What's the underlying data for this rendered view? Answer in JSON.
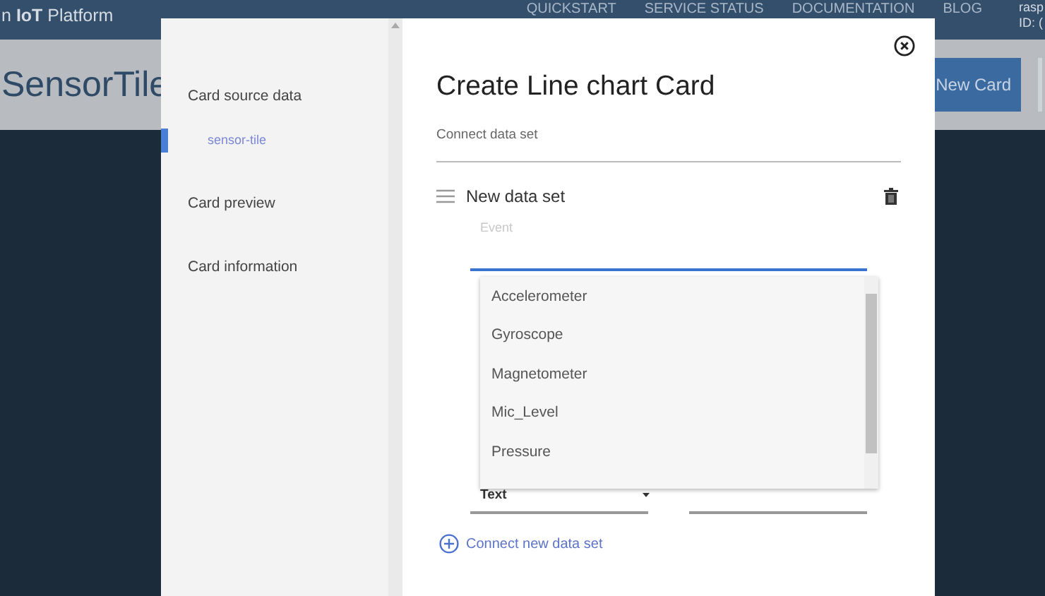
{
  "navbar": {
    "brand": "n **IoT** Platform",
    "links": [
      "QUICKSTART",
      "SERVICE STATUS",
      "DOCUMENTATION",
      "BLOG"
    ],
    "user_lines": [
      "rasp",
      "ID: ("
    ]
  },
  "page": {
    "title": "SensorTile",
    "button": "New Card"
  },
  "modal": {
    "sidebar": {
      "items": [
        {
          "label": "Card source data",
          "children": [
            {
              "label": "sensor-tile",
              "selected": true
            }
          ]
        },
        {
          "label": "Card preview"
        },
        {
          "label": "Card information"
        }
      ]
    },
    "title": "Create Line chart Card",
    "subtitle": "Connect data set",
    "data_set": {
      "name": "New data set",
      "event": {
        "placeholder": "Event",
        "focused": true
      },
      "options": [
        "Accelerometer",
        "Gyroscope",
        "Magnetometer",
        "Mic_Level",
        "Pressure"
      ],
      "type_select": {
        "value": "Text"
      }
    },
    "add_link": "Connect new data set"
  }
}
